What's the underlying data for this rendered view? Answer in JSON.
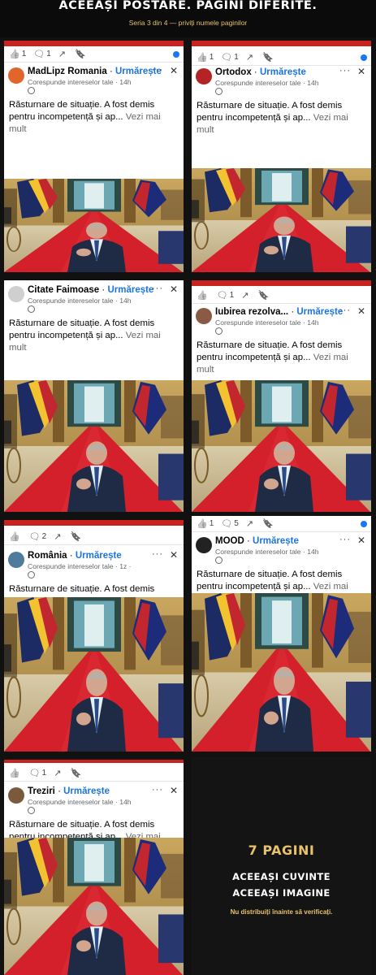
{
  "header": {
    "title": "ACEEAȘI POSTARE. PAGINI DIFERITE.",
    "subtitle": "Seria 3 din 4 — priviți numele paginilor"
  },
  "post": {
    "text_line1": "Răsturnare de situație. A fost demis",
    "text_line2": "pentru incompetență și ap...",
    "see_more": "Vezi mai mult",
    "follow": "Urmărește",
    "meta": "Corespunde intereselor tale · 14h",
    "more_icon": "more-dots-icon",
    "close_icon": "close-icon"
  },
  "cards": [
    {
      "page": "MadLipz Romania",
      "sep": " · ",
      "meta": "Corespunde intereselor tale · 14h",
      "reactions": [
        "1",
        "1"
      ],
      "avatar_color": "#e2662c",
      "has_blue_dot": true
    },
    {
      "page": "Ortodox",
      "sep": " · ",
      "meta": "Corespunde intereselor tale · 14h",
      "reactions": [
        "1",
        "1"
      ],
      "avatar_color": "#b52424",
      "has_blue_dot": true
    },
    {
      "page": "Citate Faimoase",
      "sep": " · ",
      "meta": "Corespunde intereselor tale · 14h",
      "reactions": [],
      "avatar_color": "#cfcfcf",
      "has_blue_dot": false
    },
    {
      "page": "Iubirea rezolva...",
      "sep": " · ",
      "meta": "Corespunde intereselor tale · 14h",
      "reactions": [
        "",
        "1"
      ],
      "avatar_color": "#8a5a44",
      "has_blue_dot": false
    },
    {
      "page": "România",
      "sep": " · ",
      "meta": "Corespunde intereselor tale · 1z · ",
      "reactions": [
        "",
        "2"
      ],
      "avatar_color": "#4f7c9c",
      "has_blue_dot": false
    },
    {
      "page": "MOOD",
      "sep": " · ",
      "meta": "Corespunde intereselor tale · 14h",
      "reactions": [
        "1",
        "5"
      ],
      "avatar_color": "#222222",
      "has_blue_dot": true
    },
    {
      "page": "Treziri",
      "sep": " · ",
      "meta": "Corespunde intereselor tale · 14h",
      "reactions": [
        "",
        "1"
      ],
      "avatar_color": "#7a5a3a",
      "has_blue_dot": false
    }
  ],
  "panel": {
    "count": "7 PAGINI",
    "line1": "ACEEAȘI CUVINTE",
    "line2": "ACEEAȘI IMAGINE",
    "warning": "Nu distribuiți înainte să verificați."
  },
  "colors": {
    "accent_gold": "#e8c26a",
    "facebook_blue": "#1b74e4",
    "red_bar": "#c8231f",
    "carpet_red": "#d4202a"
  },
  "icons": [
    "like-icon",
    "comment-icon",
    "share-icon",
    "save-icon",
    "globe-icon",
    "more-dots-icon",
    "close-icon"
  ]
}
